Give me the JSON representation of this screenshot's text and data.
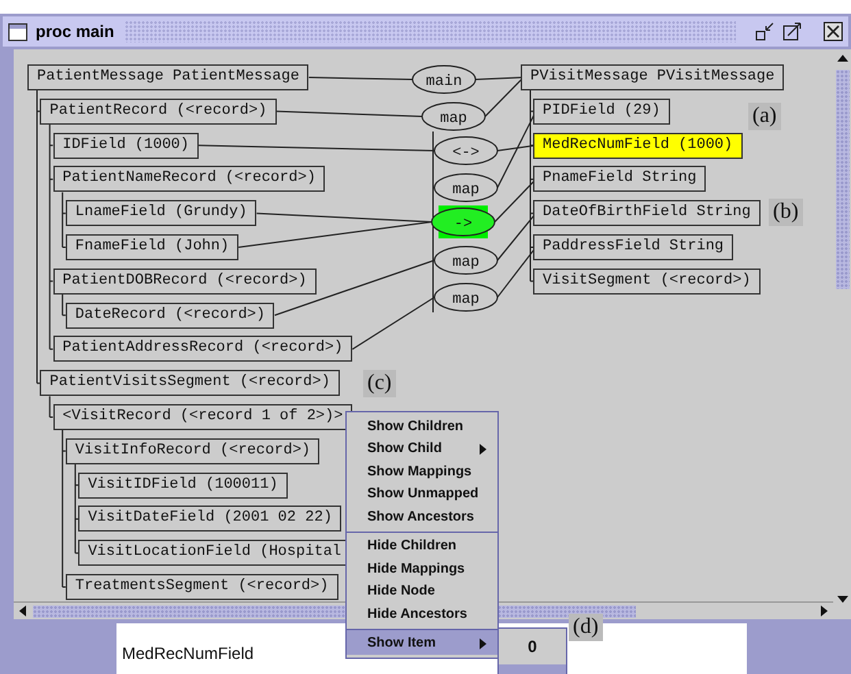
{
  "window": {
    "title": "proc main"
  },
  "source_tree": {
    "label": "PatientMessage PatientMessage",
    "children": [
      {
        "label": "PatientRecord (<record>)",
        "children": [
          {
            "label": "IDField (1000)"
          },
          {
            "label": "PatientNameRecord (<record>)",
            "children": [
              {
                "label": "LnameField (Grundy)"
              },
              {
                "label": "FnameField (John)"
              }
            ]
          },
          {
            "label": "PatientDOBRecord (<record>)",
            "children": [
              {
                "label": "DateRecord (<record>)"
              }
            ]
          },
          {
            "label": "PatientAddressRecord (<record>)"
          }
        ]
      },
      {
        "label": "PatientVisitsSegment (<record>)",
        "children": [
          {
            "label": "<VisitRecord (<record 1 of 2>)>",
            "children": [
              {
                "label": "VisitInfoRecord (<record>)",
                "children": [
                  {
                    "label": "VisitIDField (100011)"
                  },
                  {
                    "label": "VisitDateField (2001 02 22)"
                  },
                  {
                    "label": "VisitLocationField (Hospital"
                  }
                ]
              },
              {
                "label": "TreatmentsSegment (<record>)"
              }
            ]
          }
        ]
      }
    ]
  },
  "target_tree": {
    "label": "PVisitMessage PVisitMessage",
    "highlighted": false,
    "children": [
      {
        "label": "PIDField (29)",
        "highlighted": false
      },
      {
        "label": "MedRecNumField (1000)",
        "highlighted": true
      },
      {
        "label": "PnameField String",
        "highlighted": false
      },
      {
        "label": "DateOfBirthField String",
        "highlighted": false
      },
      {
        "label": "PaddressField String",
        "highlighted": false
      },
      {
        "label": "VisitSegment (<record>)",
        "highlighted": false
      }
    ]
  },
  "operators": [
    {
      "label": "main",
      "highlighted": false
    },
    {
      "label": "map",
      "highlighted": false
    },
    {
      "label": "<->",
      "highlighted": false
    },
    {
      "label": "map",
      "highlighted": false
    },
    {
      "label": "->",
      "highlighted": true
    },
    {
      "label": "map",
      "highlighted": false
    },
    {
      "label": "map",
      "highlighted": false
    }
  ],
  "annotations": [
    "(a)",
    "(b)",
    "(c)",
    "(d)"
  ],
  "context_menu": {
    "items": [
      {
        "label": "Show Children",
        "submenu": false,
        "separator_before": false,
        "selected": false
      },
      {
        "label": "Show Child",
        "submenu": true,
        "separator_before": false,
        "selected": false
      },
      {
        "label": "Show Mappings",
        "submenu": false,
        "separator_before": false,
        "selected": false
      },
      {
        "label": "Show Unmapped",
        "submenu": false,
        "separator_before": false,
        "selected": false
      },
      {
        "label": "Show Ancestors",
        "submenu": false,
        "separator_before": false,
        "selected": false
      },
      {
        "label": "Hide Children",
        "submenu": false,
        "separator_before": true,
        "selected": false
      },
      {
        "label": "Hide Mappings",
        "submenu": false,
        "separator_before": false,
        "selected": false
      },
      {
        "label": "Hide Node",
        "submenu": false,
        "separator_before": false,
        "selected": false
      },
      {
        "label": "Hide Ancestors",
        "submenu": false,
        "separator_before": false,
        "selected": false
      },
      {
        "label": "Show Item",
        "submenu": true,
        "separator_before": true,
        "selected": true
      }
    ]
  },
  "submenu": {
    "items": [
      {
        "label": "0",
        "selected": false
      }
    ]
  },
  "status_field": {
    "value": "MedRecNumField"
  }
}
